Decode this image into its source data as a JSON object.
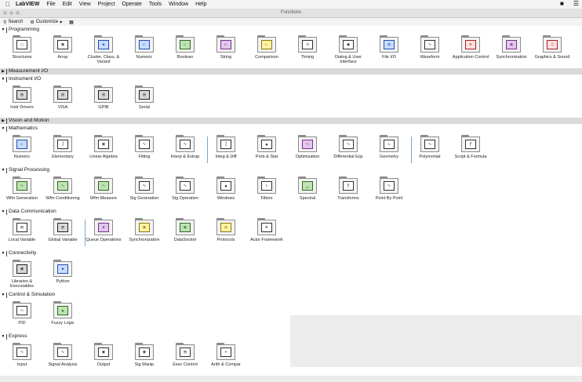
{
  "menubar": {
    "app": "LabVIEW",
    "items": [
      "File",
      "Edit",
      "View",
      "Project",
      "Operate",
      "Tools",
      "Window",
      "Help"
    ]
  },
  "window": {
    "title": "Functions"
  },
  "toolbar": {
    "search_label": "Search",
    "customize_label": "Customize"
  },
  "categories": {
    "programming": "Programming",
    "measurement_io": "Measurement I/O",
    "instrument_io": "Instrument I/O",
    "vision_motion": "Vision and Motion",
    "mathematics": "Mathematics",
    "signal_processing": "Signal Processing",
    "data_communication": "Data Communication",
    "connectivity": "Connectivity",
    "control_simulation": "Control & Simulation",
    "express": "Express"
  },
  "programming": [
    {
      "label": "Structures"
    },
    {
      "label": "Array"
    },
    {
      "label": "Cluster, Class, & Variant"
    },
    {
      "label": "Numeric"
    },
    {
      "label": "Boolean"
    },
    {
      "label": "String"
    },
    {
      "label": "Comparison"
    },
    {
      "label": "Timing"
    },
    {
      "label": "Dialog & User Interface"
    },
    {
      "label": "File I/O"
    },
    {
      "label": "Waveform"
    },
    {
      "label": "Application Control"
    },
    {
      "label": "Synchronization"
    },
    {
      "label": "Graphics & Sound"
    }
  ],
  "instrument_io": [
    {
      "label": "Instr Drivers"
    },
    {
      "label": "VISA"
    },
    {
      "label": "GPIB"
    },
    {
      "label": "Serial"
    }
  ],
  "mathematics": [
    {
      "label": "Numeric"
    },
    {
      "label": "Elementary"
    },
    {
      "label": "Linear Algebra"
    },
    {
      "label": "Fitting"
    },
    {
      "label": "Interp & Extrap"
    },
    {
      "label": "Integ & Diff"
    },
    {
      "label": "Prob & Stat"
    },
    {
      "label": "Optimization"
    },
    {
      "label": "Differential Eqs"
    },
    {
      "label": "Geometry"
    },
    {
      "label": "Polynomial"
    },
    {
      "label": "Script & Formula"
    }
  ],
  "signal_processing": [
    {
      "label": "Wfm Generation"
    },
    {
      "label": "Wfm Conditioning"
    },
    {
      "label": "Wfm Measure"
    },
    {
      "label": "Sig Generation"
    },
    {
      "label": "Sig Operation"
    },
    {
      "label": "Windows"
    },
    {
      "label": "Filters"
    },
    {
      "label": "Spectral"
    },
    {
      "label": "Transforms"
    },
    {
      "label": "Point By Point"
    }
  ],
  "data_communication": [
    {
      "label": "Local Variable"
    },
    {
      "label": "Global Variable"
    },
    {
      "label": "Queue Operations"
    },
    {
      "label": "Synchronization"
    },
    {
      "label": "DataSocket"
    },
    {
      "label": "Protocols"
    },
    {
      "label": "Actor Framework"
    }
  ],
  "connectivity": [
    {
      "label": "Libraries & Executables"
    },
    {
      "label": "Python"
    }
  ],
  "control_simulation": [
    {
      "label": "PID"
    },
    {
      "label": "Fuzzy Logic"
    }
  ],
  "express": [
    {
      "label": "Input"
    },
    {
      "label": "Signal Analysis"
    },
    {
      "label": "Output"
    },
    {
      "label": "Sig Manip"
    },
    {
      "label": "Exec Control"
    },
    {
      "label": "Arith & Compar"
    }
  ]
}
